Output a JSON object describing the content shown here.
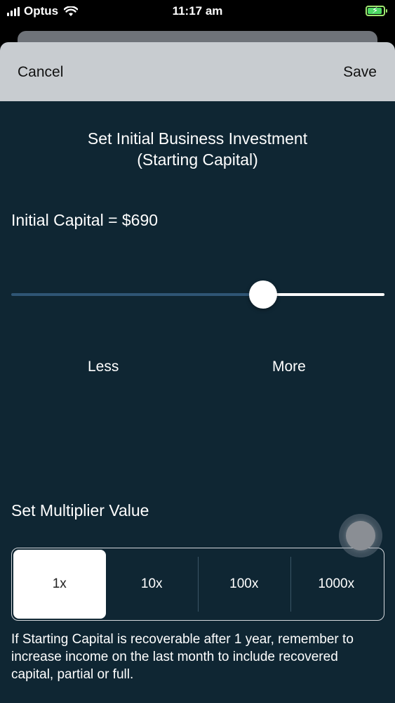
{
  "status_bar": {
    "carrier": "Optus",
    "time": "11:17 am",
    "battery_level": 0.9,
    "icons": [
      "signal-icon",
      "wifi-icon",
      "battery-charging-icon"
    ]
  },
  "nav": {
    "cancel_label": "Cancel",
    "save_label": "Save"
  },
  "title": {
    "line1": "Set Initial Business Investment",
    "line2": "(Starting Capital)"
  },
  "capital": {
    "text": "Initial Capital = $690"
  },
  "slider": {
    "value_fraction": 0.675,
    "min_label": "Less",
    "max_label": "More"
  },
  "multiplier": {
    "label": "Set Multiplier Value",
    "options": [
      "1x",
      "10x",
      "100x",
      "1000x"
    ],
    "selected_index": 0
  },
  "note": {
    "text": "If Starting Capital is recoverable after 1 year, remember to increase income on the last month to include recovered capital, partial or full."
  },
  "colors": {
    "background": "#0f2633",
    "nav_bar": "#c8ccd0",
    "slider_min_track": "#2f5575",
    "slider_max_track": "#ffffff"
  }
}
